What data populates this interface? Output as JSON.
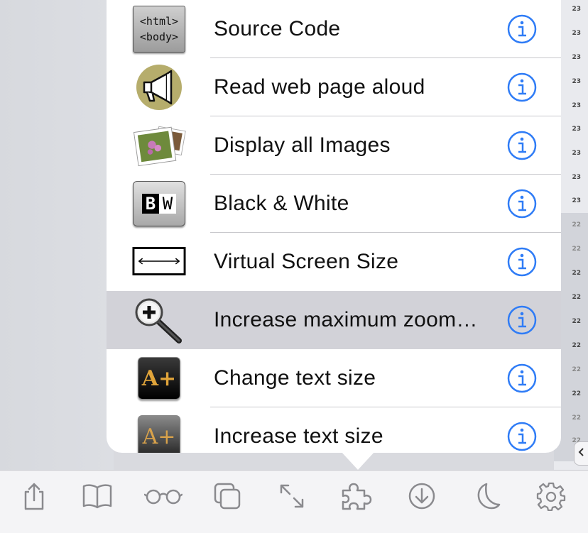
{
  "background_page": {
    "row_labels": [
      "23",
      "23",
      "23",
      "23",
      "23",
      "23",
      "23",
      "23",
      "23",
      "22",
      "22",
      "22",
      "22",
      "22",
      "22",
      "22",
      "22",
      "22",
      "22"
    ]
  },
  "menu": {
    "items": [
      {
        "label": "Source Code",
        "icon": "source-code-icon",
        "icon_text_top": "<html>",
        "icon_text_bottom": "<body>"
      },
      {
        "label": "Read web page aloud",
        "icon": "megaphone-icon"
      },
      {
        "label": "Display all Images",
        "icon": "photos-icon"
      },
      {
        "label": "Black & White",
        "icon": "black-white-icon",
        "icon_text_left": "B",
        "icon_text_right": "W"
      },
      {
        "label": "Virtual Screen Size",
        "icon": "screen-size-icon"
      },
      {
        "label": "Increase maximum zoom…",
        "icon": "magnifier-plus-icon",
        "highlighted": true
      },
      {
        "label": "Change text size",
        "icon": "text-size-icon",
        "icon_text": "A+"
      },
      {
        "label": "Increase text size",
        "icon": "increase-text-size-icon",
        "icon_text": "A+"
      }
    ],
    "info_icon": "info-icon",
    "accent_color": "#2f7cf6"
  },
  "toolbar": {
    "buttons": [
      "share-icon",
      "bookmarks-icon",
      "reading-list-icon",
      "tabs-icon",
      "fullscreen-icon",
      "extensions-icon",
      "download-icon",
      "night-mode-icon",
      "settings-icon"
    ],
    "icon_color": "#8a8a8e"
  }
}
